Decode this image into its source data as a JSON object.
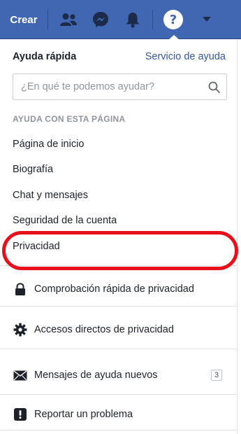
{
  "topbar": {
    "create_label": "Crear",
    "icons": [
      "friends-icon",
      "messenger-icon",
      "notifications-icon",
      "help-icon",
      "dropdown-icon"
    ],
    "help_glyph": "?"
  },
  "panel": {
    "title": "Ayuda rápida",
    "help_center_link": "Servicio de ayuda",
    "search": {
      "placeholder": "¿En qué te podemos ayudar?"
    },
    "section_title": "AYUDA CON ESTA PÁGINA",
    "help_links": [
      "Página de inicio",
      "Biografía",
      "Chat y mensajes",
      "Seguridad de la cuenta",
      "Privacidad"
    ],
    "actions": [
      {
        "label": "Comprobación rápida de privacidad",
        "icon": "lock-icon"
      },
      {
        "label": "Accesos directos de privacidad",
        "icon": "gear-icon"
      },
      {
        "label": "Mensajes de ayuda nuevos",
        "icon": "envelope-icon",
        "badge": "3"
      },
      {
        "label": "Reportar un problema",
        "icon": "alert-icon"
      }
    ]
  },
  "colors": {
    "brand": "#4267b2",
    "link": "#365899",
    "highlight": "#e8101a"
  }
}
